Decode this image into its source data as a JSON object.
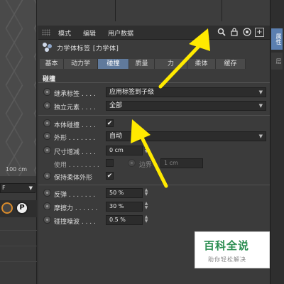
{
  "viewport": {
    "scale_label": "100 cm"
  },
  "left_dropdown": {
    "value": "F"
  },
  "left_icons": {
    "p_label": "P"
  },
  "right_tabs": [
    {
      "label": "属性"
    },
    {
      "label": "层"
    }
  ],
  "menubar": {
    "items": [
      {
        "label": "模式"
      },
      {
        "label": "编辑"
      },
      {
        "label": "用户数据"
      }
    ],
    "icons": [
      "search-icon",
      "lock-icon",
      "target-icon",
      "new-panel-icon"
    ]
  },
  "object": {
    "title": "力学体标签 [力学体]"
  },
  "tabs": [
    {
      "label": "基本",
      "active": false
    },
    {
      "label": "动力学",
      "active": false
    },
    {
      "label": "碰撞",
      "active": true
    },
    {
      "label": "质量",
      "active": false
    },
    {
      "label": "力",
      "active": false
    },
    {
      "label": "柔体",
      "active": false
    },
    {
      "label": "缓存",
      "active": false
    }
  ],
  "section": {
    "title": "碰撞"
  },
  "rows": {
    "inherit_tag": {
      "label": "继承标签 . . . .",
      "value": "应用标签到子级"
    },
    "standalone": {
      "label": "独立元素 . . . .",
      "value": "全部"
    },
    "self_collision": {
      "label": "本体碰撞 . . . .",
      "checked": "✔"
    },
    "shape": {
      "label": "外形 . . . . . . .",
      "value": "自动"
    },
    "size_increment": {
      "label": "尺寸增减 . . . .",
      "value": "0 cm"
    },
    "use": {
      "label": "使用 . . . . . . . .",
      "edge_label": "边界",
      "edge_value": "1 cm"
    },
    "keep_soft_shape": {
      "label": "保持柔体外形",
      "checked": "✔"
    },
    "bounce": {
      "label": "反弹 . . . . . . .",
      "value": "50 %"
    },
    "friction": {
      "label": "摩擦力 . . . . . .",
      "value": "30 %"
    },
    "collision_noise": {
      "label": "碰撞噪波 . . . .",
      "value": "0.5 %"
    }
  },
  "annotation_color": "#ffea00",
  "watermark": {
    "title": "百科全说",
    "subtitle": "助你轻松解决"
  }
}
